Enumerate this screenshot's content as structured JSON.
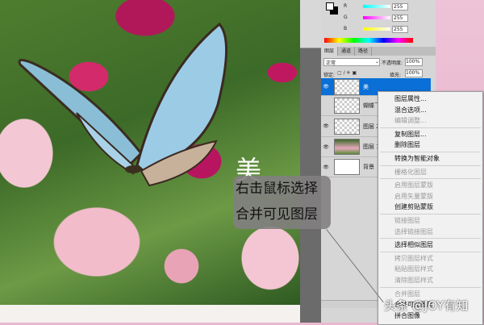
{
  "color_panel": {
    "channels": [
      {
        "label": "R",
        "value": "255"
      },
      {
        "label": "G",
        "value": "255"
      },
      {
        "label": "B",
        "value": "255"
      }
    ]
  },
  "layers_panel": {
    "tabs": [
      "图层",
      "通道",
      "路径"
    ],
    "blend_mode": "正常",
    "opacity_label": "不透明度:",
    "opacity": "100%",
    "lock_label": "锁定:",
    "fill_label": "填充:",
    "fill": "100%",
    "layers": [
      {
        "name": "美",
        "selected": true
      },
      {
        "name": "蝴蝶飞"
      },
      {
        "name": "图层 2"
      },
      {
        "name": "图层 1"
      },
      {
        "name": "背景"
      }
    ],
    "bottom_icons": "∞ fx ◘"
  },
  "context_menu": {
    "groups": [
      [
        {
          "label": "图层属性...",
          "enabled": true
        },
        {
          "label": "混合选项...",
          "enabled": true
        },
        {
          "label": "编辑调整...",
          "enabled": false
        }
      ],
      [
        {
          "label": "复制图层...",
          "enabled": true
        },
        {
          "label": "删除图层",
          "enabled": true
        }
      ],
      [
        {
          "label": "转换为智能对象",
          "enabled": true
        }
      ],
      [
        {
          "label": "栅格化图层",
          "enabled": false
        }
      ],
      [
        {
          "label": "启用图层蒙版",
          "enabled": false
        },
        {
          "label": "启用矢量蒙版",
          "enabled": false
        },
        {
          "label": "创建剪贴蒙版",
          "enabled": true
        }
      ],
      [
        {
          "label": "链接图层",
          "enabled": false
        },
        {
          "label": "选择链接图层",
          "enabled": false
        }
      ],
      [
        {
          "label": "选择相似图层",
          "enabled": true
        }
      ],
      [
        {
          "label": "拷贝图层样式",
          "enabled": false
        },
        {
          "label": "粘贴图层样式",
          "enabled": false
        },
        {
          "label": "清除图层样式",
          "enabled": false
        }
      ],
      [
        {
          "label": "合并图层",
          "enabled": false
        },
        {
          "label": "合并可见图层",
          "enabled": true
        },
        {
          "label": "拼合图像",
          "enabled": true
        }
      ]
    ]
  },
  "canvas": {
    "text": "美"
  },
  "callout": {
    "line1": "右击鼠标选择",
    "line2": "合并可见图层"
  },
  "watermark": "头条 @JOY有知"
}
